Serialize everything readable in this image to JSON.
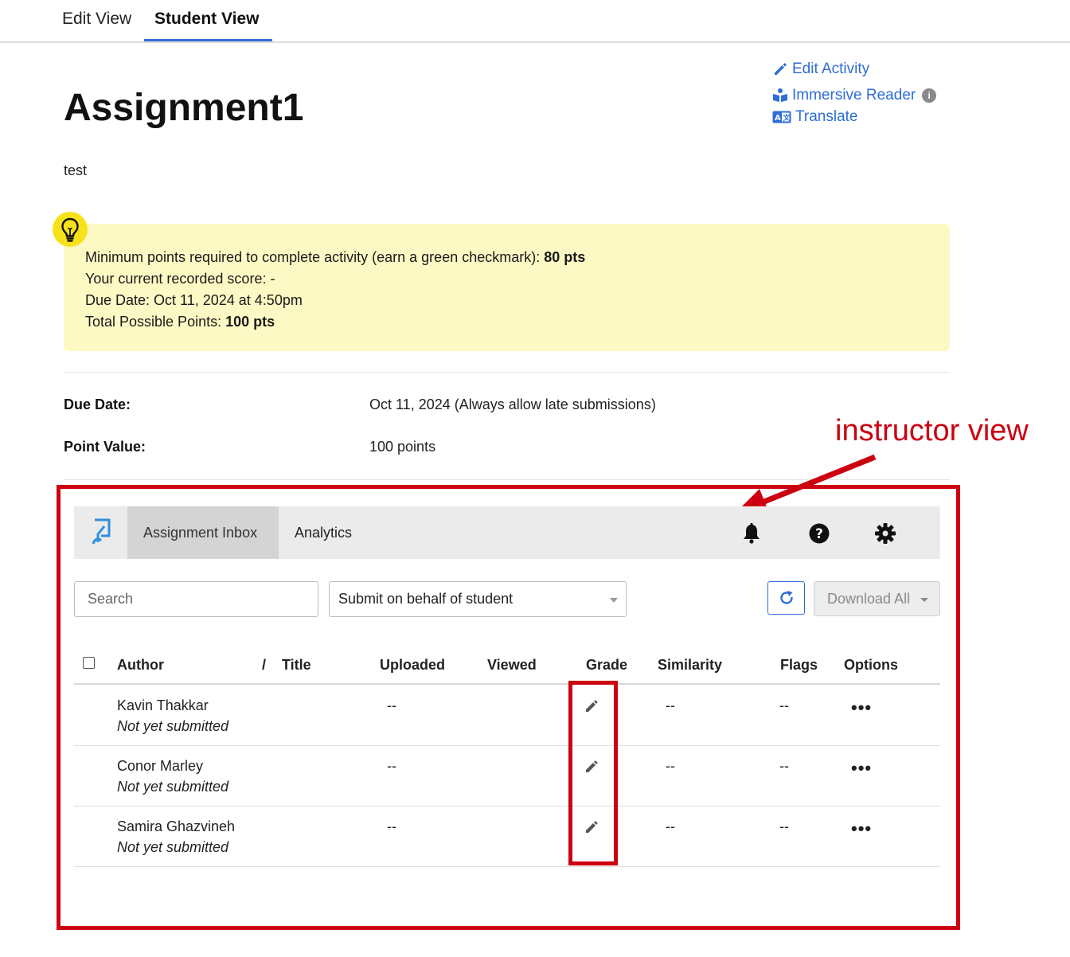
{
  "tabs": {
    "edit_view": "Edit View",
    "student_view": "Student View"
  },
  "assignment": {
    "title": "Assignment1",
    "description": "test"
  },
  "actions": {
    "edit_activity": "Edit Activity",
    "immersive_reader": "Immersive Reader",
    "info_badge": "i",
    "translate": "Translate"
  },
  "info": {
    "min_points_label": "Minimum points required to complete activity (earn a green checkmark): ",
    "min_points_value": "80 pts",
    "current_score": "Your current recorded score: -",
    "due_date": "Due Date: Oct 11, 2024 at 4:50pm",
    "total_points_label": "Total Possible Points: ",
    "total_points_value": "100 pts"
  },
  "meta": {
    "due_date_label": "Due Date:",
    "due_date_value": "Oct 11, 2024 (Always allow late submissions)",
    "point_value_label": "Point Value:",
    "point_value_value": "100 points"
  },
  "annotation": "instructor view",
  "colors": {
    "accent": "#2d6dd6",
    "annotation_red": "#cc0010",
    "info_bg": "#fdf9c4",
    "bulb": "#f5e21b"
  },
  "inbox": {
    "tab_inbox": "Assignment Inbox",
    "tab_analytics": "Analytics",
    "search_placeholder": "Search",
    "submit_on_behalf": "Submit on behalf of student",
    "download_all": "Download All",
    "columns": {
      "author": "Author",
      "slash": "/",
      "title": "Title",
      "uploaded": "Uploaded",
      "viewed": "Viewed",
      "grade": "Grade",
      "similarity": "Similarity",
      "flags": "Flags",
      "options": "Options"
    },
    "rows": [
      {
        "author": "Kavin Thakkar",
        "status": "Not yet submitted",
        "uploaded": "--",
        "similarity": "--",
        "flags": "--",
        "options": "•••"
      },
      {
        "author": "Conor Marley",
        "status": "Not yet submitted",
        "uploaded": "--",
        "similarity": "--",
        "flags": "--",
        "options": "•••"
      },
      {
        "author": "Samira Ghazvineh",
        "status": "Not yet submitted",
        "uploaded": "--",
        "similarity": "--",
        "flags": "--",
        "options": "•••"
      }
    ]
  }
}
